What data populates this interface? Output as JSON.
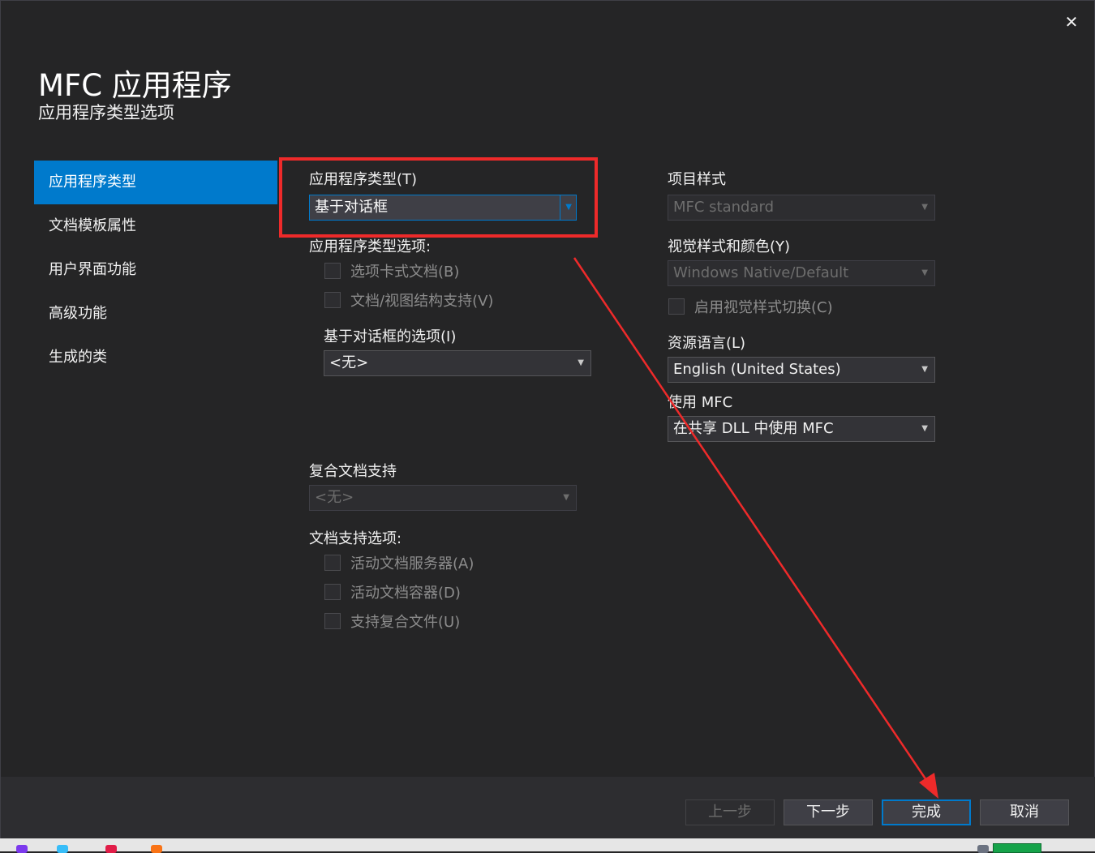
{
  "window": {
    "close_glyph": "✕",
    "title": "MFC 应用程序",
    "subtitle": "应用程序类型选项"
  },
  "sidebar": {
    "items": [
      {
        "label": "应用程序类型",
        "active": true
      },
      {
        "label": "文档模板属性"
      },
      {
        "label": "用户界面功能"
      },
      {
        "label": "高级功能"
      },
      {
        "label": "生成的类"
      }
    ]
  },
  "app_type": {
    "label": "应用程序类型(T)",
    "value": "基于对话框",
    "options_label": "应用程序类型选项:",
    "checks": [
      {
        "label": "选项卡式文档(B)",
        "checked": false,
        "enabled": false
      },
      {
        "label": "文档/视图结构支持(V)",
        "checked": false,
        "enabled": false
      }
    ],
    "dialog_options_label": "基于对话框的选项(I)",
    "dialog_options_value": "<无>"
  },
  "compound": {
    "label": "复合文档支持",
    "value": "<无>",
    "doc_support_label": "文档支持选项:",
    "checks": [
      {
        "label": "活动文档服务器(A)",
        "checked": false,
        "enabled": false
      },
      {
        "label": "活动文档容器(D)",
        "checked": false,
        "enabled": false
      },
      {
        "label": "支持复合文件(U)",
        "checked": false,
        "enabled": false
      }
    ]
  },
  "right": {
    "project_style_label": "项目样式",
    "project_style_value": "MFC standard",
    "visual_style_label": "视觉样式和颜色(Y)",
    "visual_style_value": "Windows Native/Default",
    "visual_switch_label": "启用视觉样式切换(C)",
    "resource_lang_label": "资源语言(L)",
    "resource_lang_value": "English (United States)",
    "use_mfc_label": "使用 MFC",
    "use_mfc_value": "在共享 DLL 中使用 MFC"
  },
  "footer": {
    "prev": "上一步",
    "next": "下一步",
    "finish": "完成",
    "cancel": "取消"
  },
  "annotation": {
    "color": "#ee2a2a"
  }
}
